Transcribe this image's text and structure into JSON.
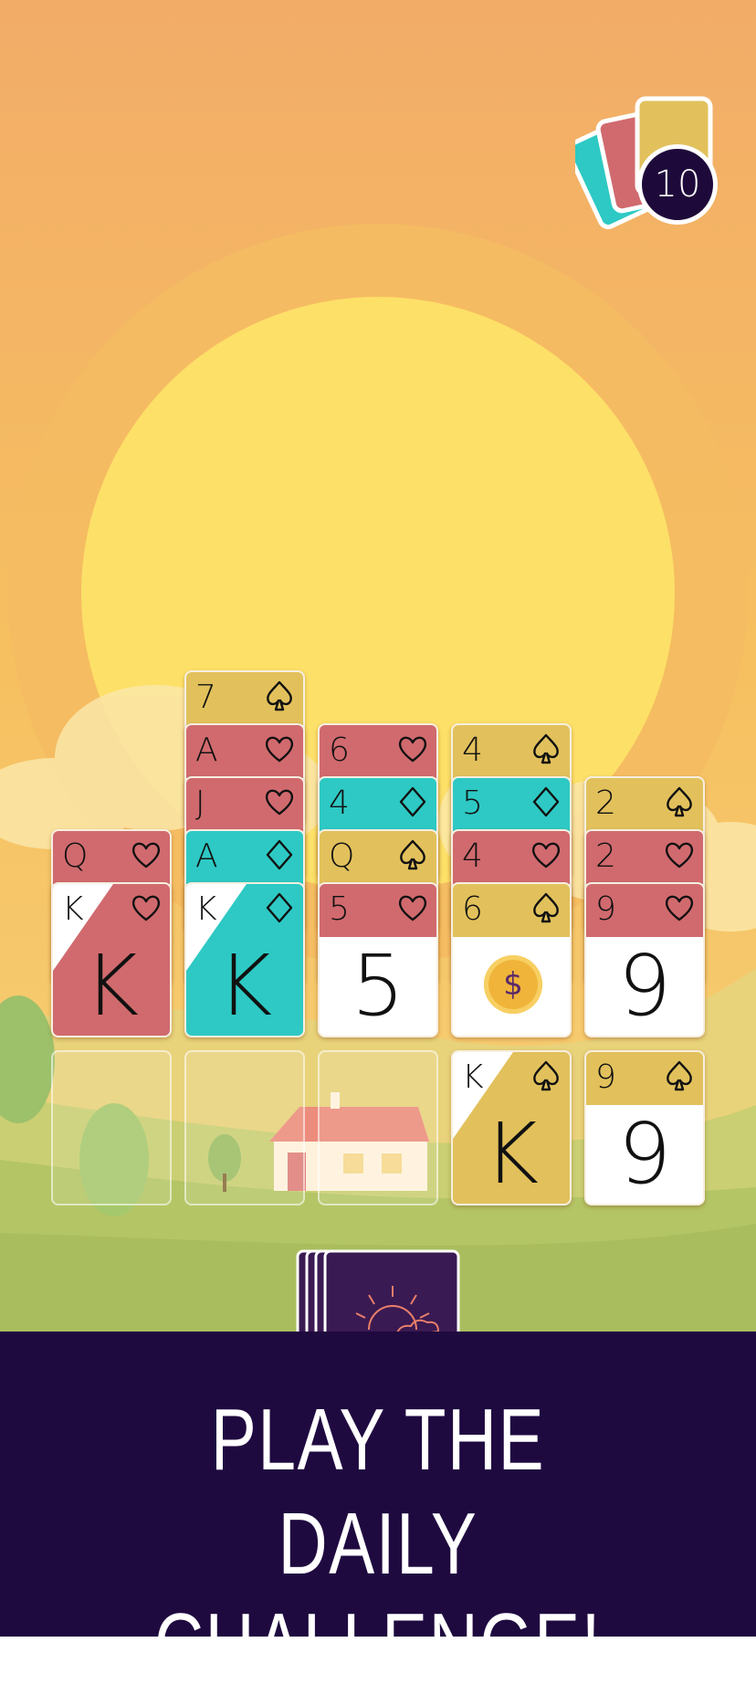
{
  "deck_counter": {
    "count": "10"
  },
  "colors": {
    "red": "#d06a6e",
    "teal": "#2ec9c4",
    "gold": "#e2c15c",
    "footer": "#1f0a40",
    "sky": "#f2ae6a",
    "sun": "#fde068"
  },
  "tableau": [
    {
      "column": 1,
      "cards": [
        {
          "rank": "Q",
          "suit": "heart",
          "color": "red"
        },
        {
          "rank": "K",
          "suit": "heart",
          "color": "red",
          "face": "K",
          "style": "diagonal"
        }
      ]
    },
    {
      "column": 2,
      "cards": [
        {
          "rank": "7",
          "suit": "spade",
          "color": "gold"
        },
        {
          "rank": "A",
          "suit": "heart",
          "color": "red"
        },
        {
          "rank": "J",
          "suit": "heart",
          "color": "red"
        },
        {
          "rank": "A",
          "suit": "diamond",
          "color": "teal"
        },
        {
          "rank": "K",
          "suit": "diamond",
          "color": "teal",
          "face": "K",
          "style": "diagonal"
        }
      ]
    },
    {
      "column": 3,
      "cards": [
        {
          "rank": "6",
          "suit": "heart",
          "color": "red"
        },
        {
          "rank": "4",
          "suit": "diamond",
          "color": "teal"
        },
        {
          "rank": "Q",
          "suit": "spade",
          "color": "gold"
        },
        {
          "rank": "5",
          "suit": "heart",
          "color": "red",
          "face": "5",
          "style": "band"
        }
      ]
    },
    {
      "column": 4,
      "cards": [
        {
          "rank": "4",
          "suit": "spade",
          "color": "gold"
        },
        {
          "rank": "5",
          "suit": "diamond",
          "color": "teal"
        },
        {
          "rank": "4",
          "suit": "heart",
          "color": "red"
        },
        {
          "rank": "6",
          "suit": "spade",
          "color": "gold",
          "face": "$",
          "style": "coin"
        }
      ]
    },
    {
      "column": 5,
      "cards": [
        {
          "rank": "2",
          "suit": "spade",
          "color": "gold"
        },
        {
          "rank": "2",
          "suit": "heart",
          "color": "red"
        },
        {
          "rank": "9",
          "suit": "heart",
          "color": "red",
          "face": "9",
          "style": "band"
        }
      ]
    }
  ],
  "foundations": [
    {
      "slot": 1,
      "empty": true
    },
    {
      "slot": 2,
      "empty": true
    },
    {
      "slot": 3,
      "empty": true
    },
    {
      "slot": 4,
      "rank": "K",
      "suit": "spade",
      "color": "gold",
      "face": "K",
      "style": "diagonal"
    },
    {
      "slot": 5,
      "rank": "9",
      "suit": "spade",
      "color": "gold",
      "face": "9",
      "style": "band"
    }
  ],
  "stock": {
    "icon": "sun-cloud-icon"
  },
  "footer": {
    "line1": "PLAY THE",
    "line2": "DAILY CHALLENGE!"
  }
}
